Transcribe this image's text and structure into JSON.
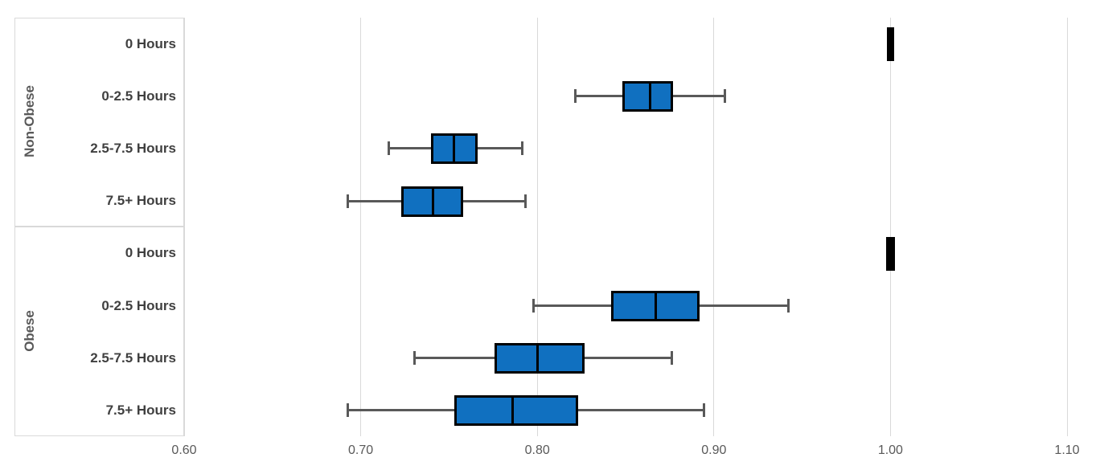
{
  "axis": {
    "tick_labels": [
      "0.60",
      "0.70",
      "0.80",
      "0.90",
      "1.00",
      "1.10"
    ],
    "min": 0.6,
    "max": 1.1
  },
  "groups": [
    {
      "title": "Non-Obese"
    },
    {
      "title": "Obese"
    }
  ],
  "categories": [
    "0 Hours",
    "0-2.5 Hours",
    "2.5-7.5 Hours",
    "7.5+ Hours",
    "0 Hours",
    "0-2.5 Hours",
    "2.5-7.5 Hours",
    "7.5+ Hours"
  ],
  "colors": {
    "box_fill": "#1070C0",
    "box_border": "#000000",
    "whisker": "#595959",
    "gridline": "#d9d9d9",
    "label_text": "#404040",
    "group_text": "#595959",
    "tick_text": "#595959"
  },
  "chart_data": {
    "type": "box",
    "title": "",
    "xlabel": "",
    "ylabel": "",
    "orientation": "horizontal",
    "xlim": [
      0.6,
      1.1
    ],
    "xticks": [
      0.6,
      0.7,
      0.8,
      0.9,
      1.0,
      1.1
    ],
    "grid": true,
    "legend": "none",
    "group_labels": [
      "Non-Obese",
      "Obese"
    ],
    "categories": [
      "0 Hours",
      "0-2.5 Hours",
      "2.5-7.5 Hours",
      "7.5+ Hours",
      "0 Hours",
      "0-2.5 Hours",
      "2.5-7.5 Hours",
      "7.5+ Hours"
    ],
    "boxes": [
      {
        "group": "Non-Obese",
        "category": "0 Hours",
        "whisker_low": 1.0,
        "q1": 1.0,
        "median": 1.0,
        "q3": 1.0,
        "whisker_high": 1.0,
        "degenerate": true
      },
      {
        "group": "Non-Obese",
        "category": "0-2.5 Hours",
        "whisker_low": 0.821,
        "q1": 0.848,
        "median": 0.864,
        "q3": 0.877,
        "whisker_high": 0.907,
        "degenerate": false
      },
      {
        "group": "Non-Obese",
        "category": "2.5-7.5 Hours",
        "whisker_low": 0.715,
        "q1": 0.74,
        "median": 0.753,
        "q3": 0.766,
        "whisker_high": 0.792,
        "degenerate": false
      },
      {
        "group": "Non-Obese",
        "category": "7.5+ Hours",
        "whisker_low": 0.692,
        "q1": 0.723,
        "median": 0.741,
        "q3": 0.758,
        "whisker_high": 0.794,
        "degenerate": false
      },
      {
        "group": "Obese",
        "category": "0 Hours",
        "whisker_low": 1.0,
        "q1": 1.0,
        "median": 1.0,
        "q3": 1.0,
        "whisker_high": 1.0,
        "degenerate": true
      },
      {
        "group": "Obese",
        "category": "0-2.5 Hours",
        "whisker_low": 0.797,
        "q1": 0.842,
        "median": 0.867,
        "q3": 0.892,
        "whisker_high": 0.943,
        "degenerate": false
      },
      {
        "group": "Obese",
        "category": "2.5-7.5 Hours",
        "whisker_low": 0.73,
        "q1": 0.776,
        "median": 0.8,
        "q3": 0.827,
        "whisker_high": 0.877,
        "degenerate": false
      },
      {
        "group": "Obese",
        "category": "7.5+ Hours",
        "whisker_low": 0.692,
        "q1": 0.753,
        "median": 0.786,
        "q3": 0.823,
        "whisker_high": 0.895,
        "degenerate": false
      }
    ]
  }
}
